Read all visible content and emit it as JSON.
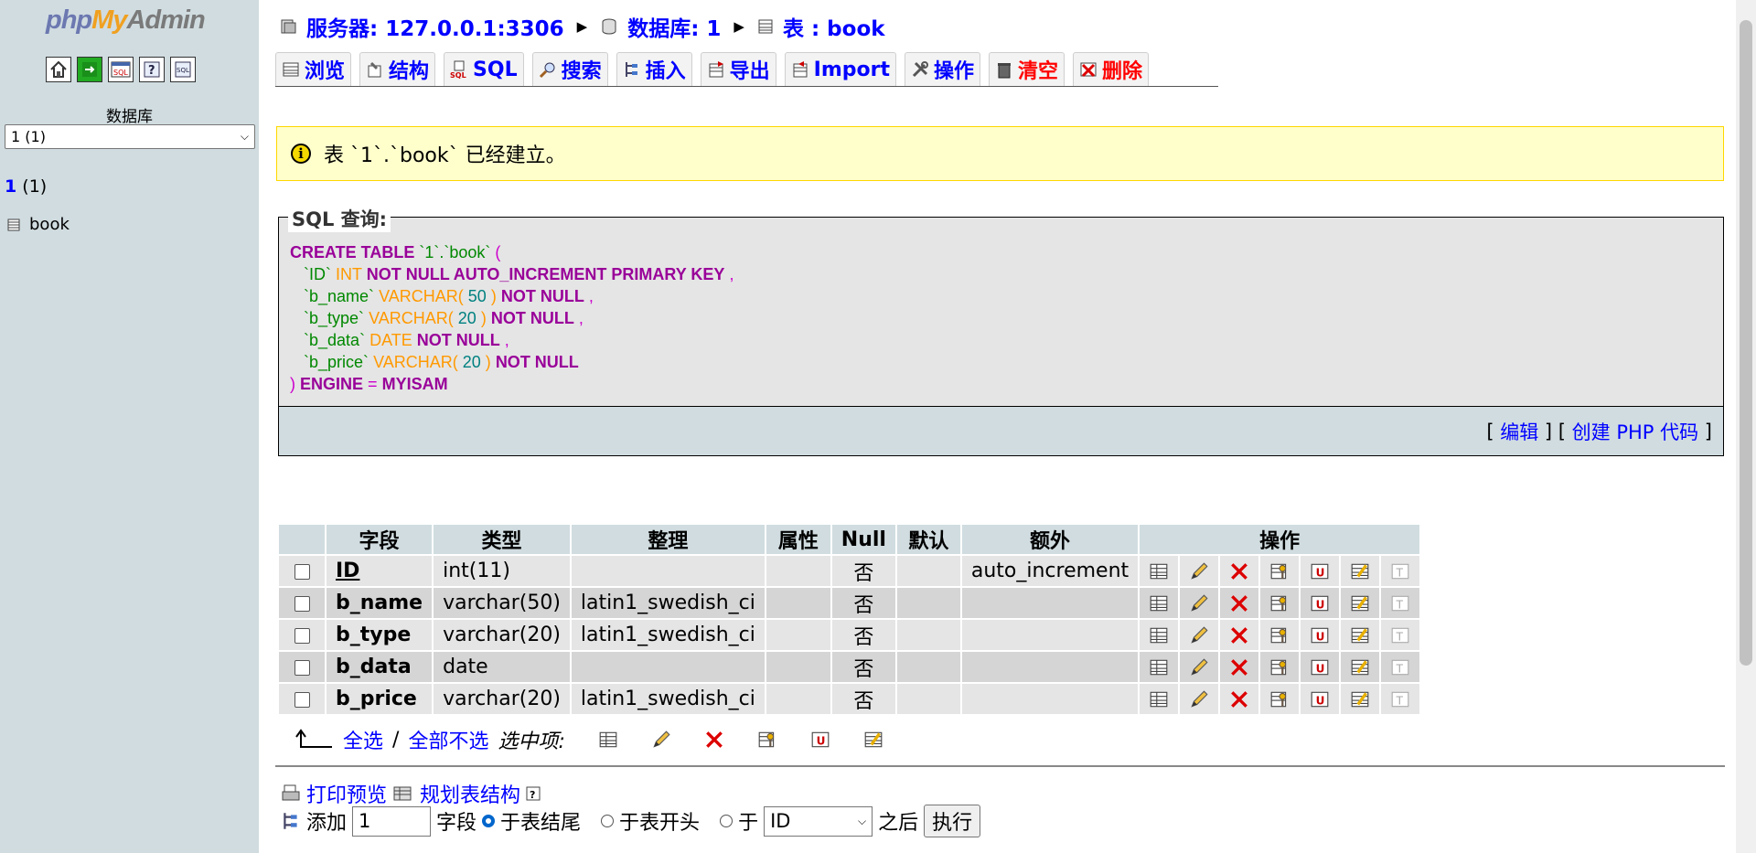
{
  "left": {
    "logo": {
      "php": "php",
      "my": "My",
      "admin": "Admin"
    },
    "icons": [
      "home-icon",
      "exit-icon",
      "sql-window-icon",
      "help-icon",
      "sql-docs-icon"
    ],
    "db_label": "数据库",
    "db_select_value": "1 (1)",
    "db_link_name": "1",
    "db_link_count": "(1)",
    "tables": [
      "book"
    ]
  },
  "breadcrumb": {
    "server": "服务器: 127.0.0.1:3306",
    "database": "数据库: 1",
    "table": "表 : book"
  },
  "tabs": [
    {
      "label": "浏览",
      "icon": "browse-icon"
    },
    {
      "label": "结构",
      "icon": "structure-icon"
    },
    {
      "label": "SQL",
      "icon": "sql-icon"
    },
    {
      "label": "搜索",
      "icon": "search-icon"
    },
    {
      "label": "插入",
      "icon": "insert-icon"
    },
    {
      "label": "导出",
      "icon": "export-icon"
    },
    {
      "label": "Import",
      "icon": "import-icon"
    },
    {
      "label": "操作",
      "icon": "operations-icon"
    },
    {
      "label": "清空",
      "icon": "empty-icon"
    },
    {
      "label": "删除",
      "icon": "drop-icon"
    }
  ],
  "notice": "表 `1`.`book` 已经建立。",
  "sql": {
    "legend": "SQL 查询:",
    "edit_link": "编辑",
    "php_link": "创建 PHP 代码",
    "bracket_open": "[",
    "bracket_mid": "] [",
    "bracket_close": "]"
  },
  "structure": {
    "headers": [
      "字段",
      "类型",
      "整理",
      "属性",
      "Null",
      "默认",
      "额外",
      "操作"
    ],
    "rows": [
      {
        "field": "ID",
        "type": "int(11)",
        "collation": "",
        "attributes": "",
        "null": "否",
        "default": "",
        "extra": "auto_increment"
      },
      {
        "field": "b_name",
        "type": "varchar(50)",
        "collation": "latin1_swedish_ci",
        "attributes": "",
        "null": "否",
        "default": "",
        "extra": ""
      },
      {
        "field": "b_type",
        "type": "varchar(20)",
        "collation": "latin1_swedish_ci",
        "attributes": "",
        "null": "否",
        "default": "",
        "extra": ""
      },
      {
        "field": "b_data",
        "type": "date",
        "collation": "",
        "attributes": "",
        "null": "否",
        "default": "",
        "extra": ""
      },
      {
        "field": "b_price",
        "type": "varchar(20)",
        "collation": "latin1_swedish_ci",
        "attributes": "",
        "null": "否",
        "default": "",
        "extra": ""
      }
    ],
    "select_all": "全选",
    "separator": "/",
    "select_none": "全部不选",
    "with_selected": "选中项:"
  },
  "bottom": {
    "print_view": "打印预览",
    "propose_structure": "规划表结构",
    "add_label": "添加",
    "add_count": "1",
    "field_label": "字段",
    "at_end": "于表结尾",
    "at_begin": "于表开头",
    "after_prefix": "于",
    "after_field": "ID",
    "after_suffix": "之后",
    "go_button": "执行"
  },
  "colors": {
    "left_bg": "#d0dce0",
    "link": "#0000ff",
    "danger": "#ff0000",
    "notice_bg": "#ffffcc",
    "sql_keyword": "#990099"
  }
}
